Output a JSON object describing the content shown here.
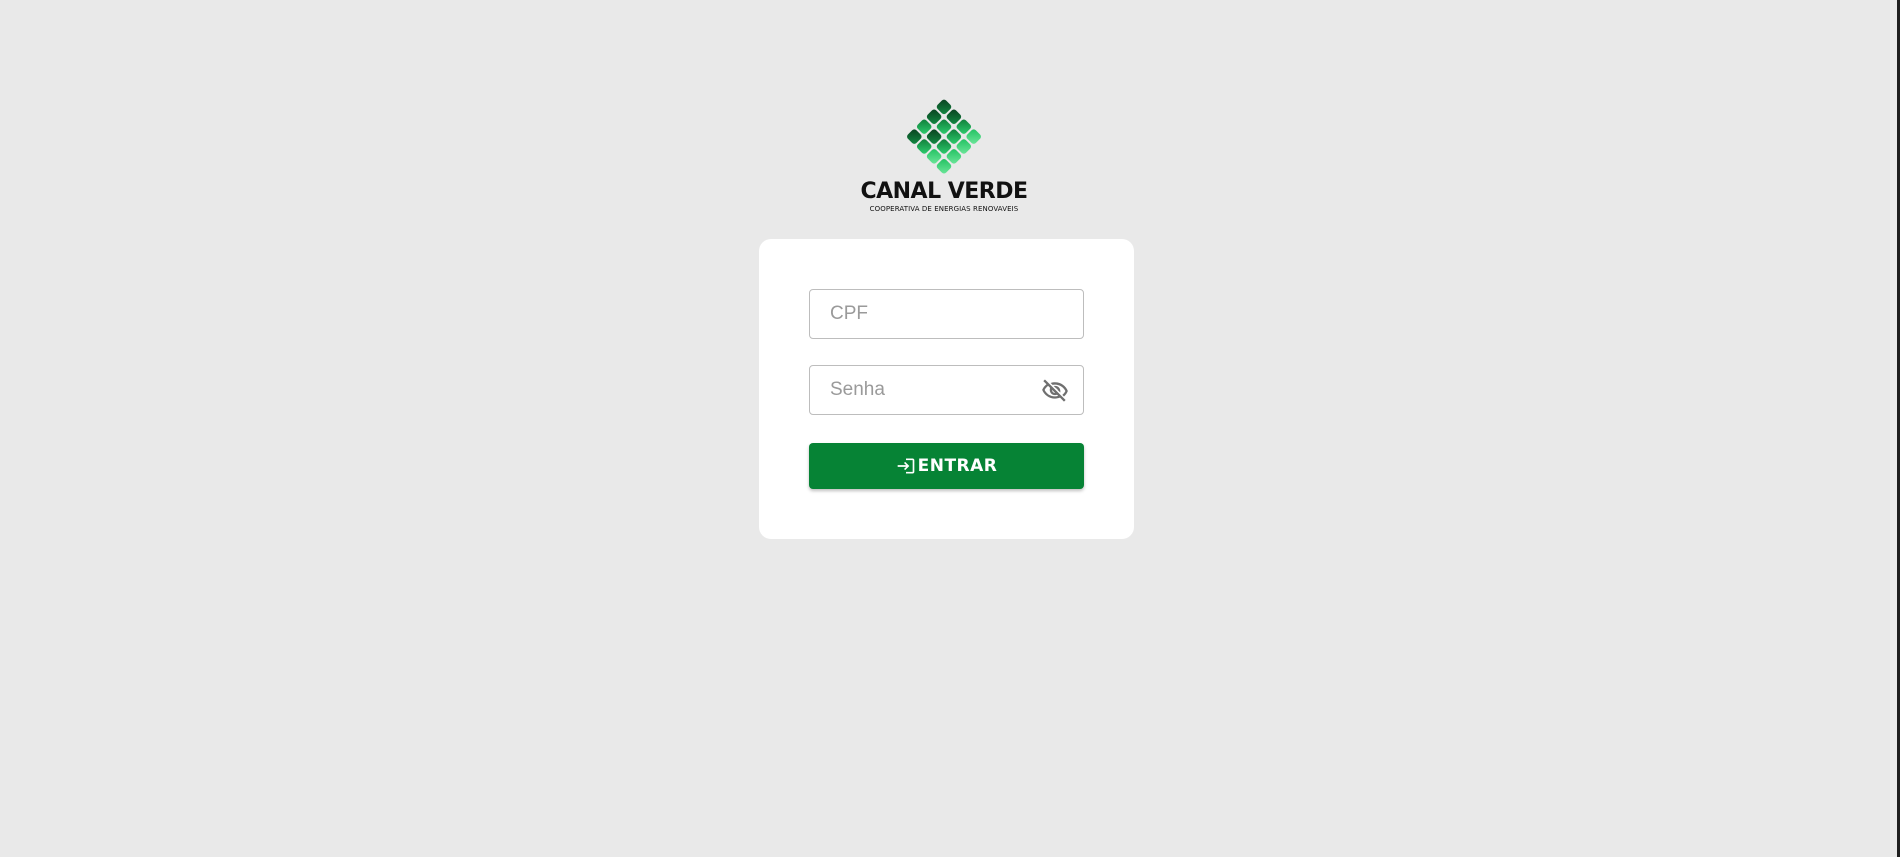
{
  "brand": {
    "name": "CANAL VERDE",
    "tagline": "COOPERATIVA DE ENERGIAS RENOVAVEIS",
    "colors": {
      "dark_green": "#0b4f26",
      "mid_green": "#0f8a3d",
      "light_green": "#2ecc71",
      "button_green": "#068335"
    }
  },
  "login": {
    "cpf": {
      "placeholder": "CPF",
      "value": ""
    },
    "senha": {
      "placeholder": "Senha",
      "value": "",
      "toggle_icon": "eye-off-icon"
    },
    "submit": {
      "label": "ENTRAR",
      "icon": "login-icon"
    }
  }
}
